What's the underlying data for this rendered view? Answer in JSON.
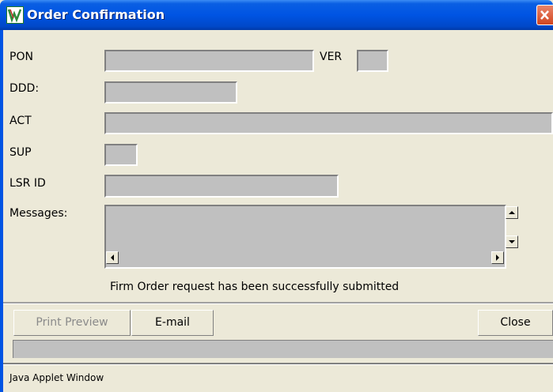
{
  "window": {
    "title": "Order Confirmation",
    "icon": "java-app-icon",
    "close_icon": "close-icon"
  },
  "form": {
    "pon_label": "PON",
    "pon_value": "",
    "ver_label": "VER",
    "ver_value": "",
    "ddd_label": "DDD:",
    "ddd_value": "",
    "act_label": "ACT",
    "act_value": "",
    "sup_label": "SUP",
    "sup_value": "",
    "lsr_label": "LSR ID",
    "lsr_value": "",
    "messages_label": "Messages:",
    "messages_value": ""
  },
  "status_message": "Firm Order request has been successfully submitted",
  "buttons": {
    "print_preview": "Print Preview",
    "email": "E-mail",
    "close": "Close"
  },
  "status_bar": {
    "text": ""
  },
  "footer": {
    "applet_label": "Java Applet Window"
  },
  "colors": {
    "titlebar": "#0054e3",
    "window_bg": "#ece9d8",
    "field_bg": "#c0c0c0",
    "close_button": "#d2461f"
  }
}
